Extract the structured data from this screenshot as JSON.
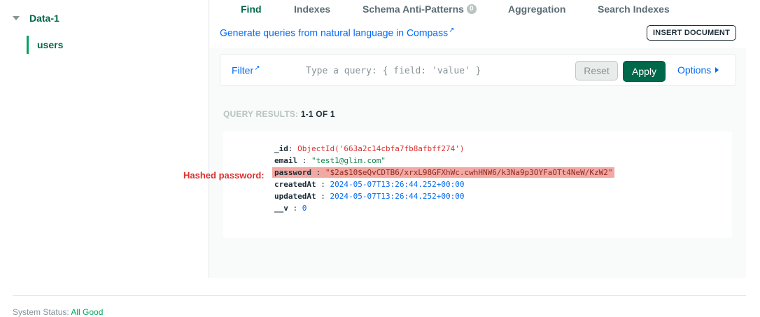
{
  "sidebar": {
    "database": "Data-1",
    "collection": "users"
  },
  "tabs": [
    {
      "label": "Find"
    },
    {
      "label": "Indexes"
    },
    {
      "label": "Schema Anti-Patterns",
      "badge": "0"
    },
    {
      "label": "Aggregation"
    },
    {
      "label": "Search Indexes"
    }
  ],
  "topbar": {
    "generate_link": "Generate queries from natural language in Compass",
    "insert_button": "INSERT DOCUMENT"
  },
  "filter": {
    "label": "Filter",
    "placeholder": "Type a query: { field: 'value' }",
    "reset": "Reset",
    "apply": "Apply",
    "options": "Options"
  },
  "results": {
    "label": "QUERY RESULTS:",
    "count": "1-1 OF 1"
  },
  "document": {
    "fields": [
      {
        "key": "_id",
        "value": "ObjectId('663a2c14cbfa7fb8afbff274')"
      },
      {
        "key": "email",
        "value": "\"test1@glim.com\""
      },
      {
        "key": "password",
        "value": "\"$2a$10$eQvCDTB6/xrxL98GFXhWc.cwhHNW6/k3Na9p3OYFaOTt4NeW/KzW2\""
      },
      {
        "key": "createdAt",
        "value": "2024-05-07T13:26:44.252+00:00"
      },
      {
        "key": "updatedAt",
        "value": "2024-05-07T13:26:44.252+00:00"
      },
      {
        "key": "__v",
        "value": "0"
      }
    ]
  },
  "annotation": "Hashed password:",
  "footer": {
    "label": "System Status:",
    "status": "All Good"
  },
  "colors": {
    "brand_green": "#00684a",
    "link_blue": "#016bf8",
    "highlight": "#f2a8a3",
    "annotation_red": "#db3030"
  }
}
